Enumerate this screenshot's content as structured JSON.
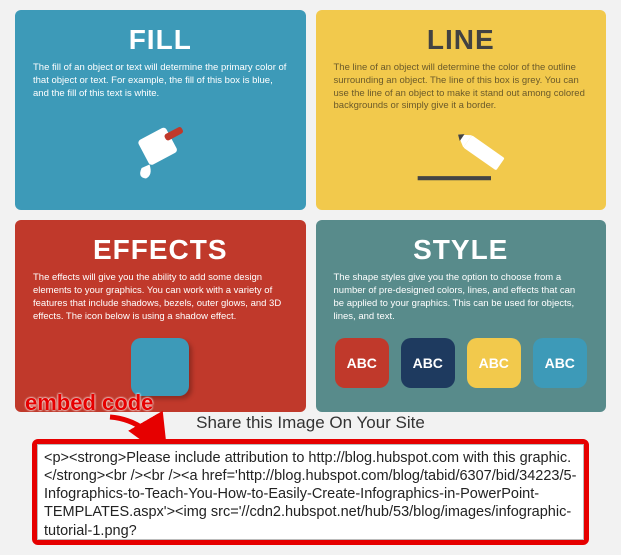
{
  "cards": {
    "fill": {
      "title": "FILL",
      "body": "The fill of an object or text will determine the primary color of that object or text. For example, the fill of this box is blue, and the fill of this text is white."
    },
    "line": {
      "title": "LINE",
      "body": "The line of an object will determine the color of the outline surrounding an object. The line of this box is grey. You can use the line of an object to make it stand out among colored backgrounds or simply give it a border."
    },
    "effects": {
      "title": "EFFECTS",
      "body": "The effects will give you the ability to add some design elements to your graphics. You can work with a variety of features that include shadows, bezels, outer glows, and 3D effects. The icon below is using a shadow effect."
    },
    "style": {
      "title": "STYLE",
      "body": "The shape styles give you the option to choose from a number of pre-designed colors, lines, and effects that can be applied to your graphics. This can be used for objects, lines, and text.",
      "swatch_label": "ABC"
    }
  },
  "annotation": {
    "label": "embed code"
  },
  "share": {
    "heading": "Share this Image On Your Site",
    "code": "<p><strong>Please include attribution to http://blog.hubspot.com with this graphic.</strong><br /><br /><a href='http://blog.hubspot.com/blog/tabid/6307/bid/34223/5-Infographics-to-Teach-You-How-to-Easily-Create-Infographics-in-PowerPoint-TEMPLATES.aspx'><img src='//cdn2.hubspot.net/hub/53/blog/images/infographic-tutorial-1.png?"
  }
}
